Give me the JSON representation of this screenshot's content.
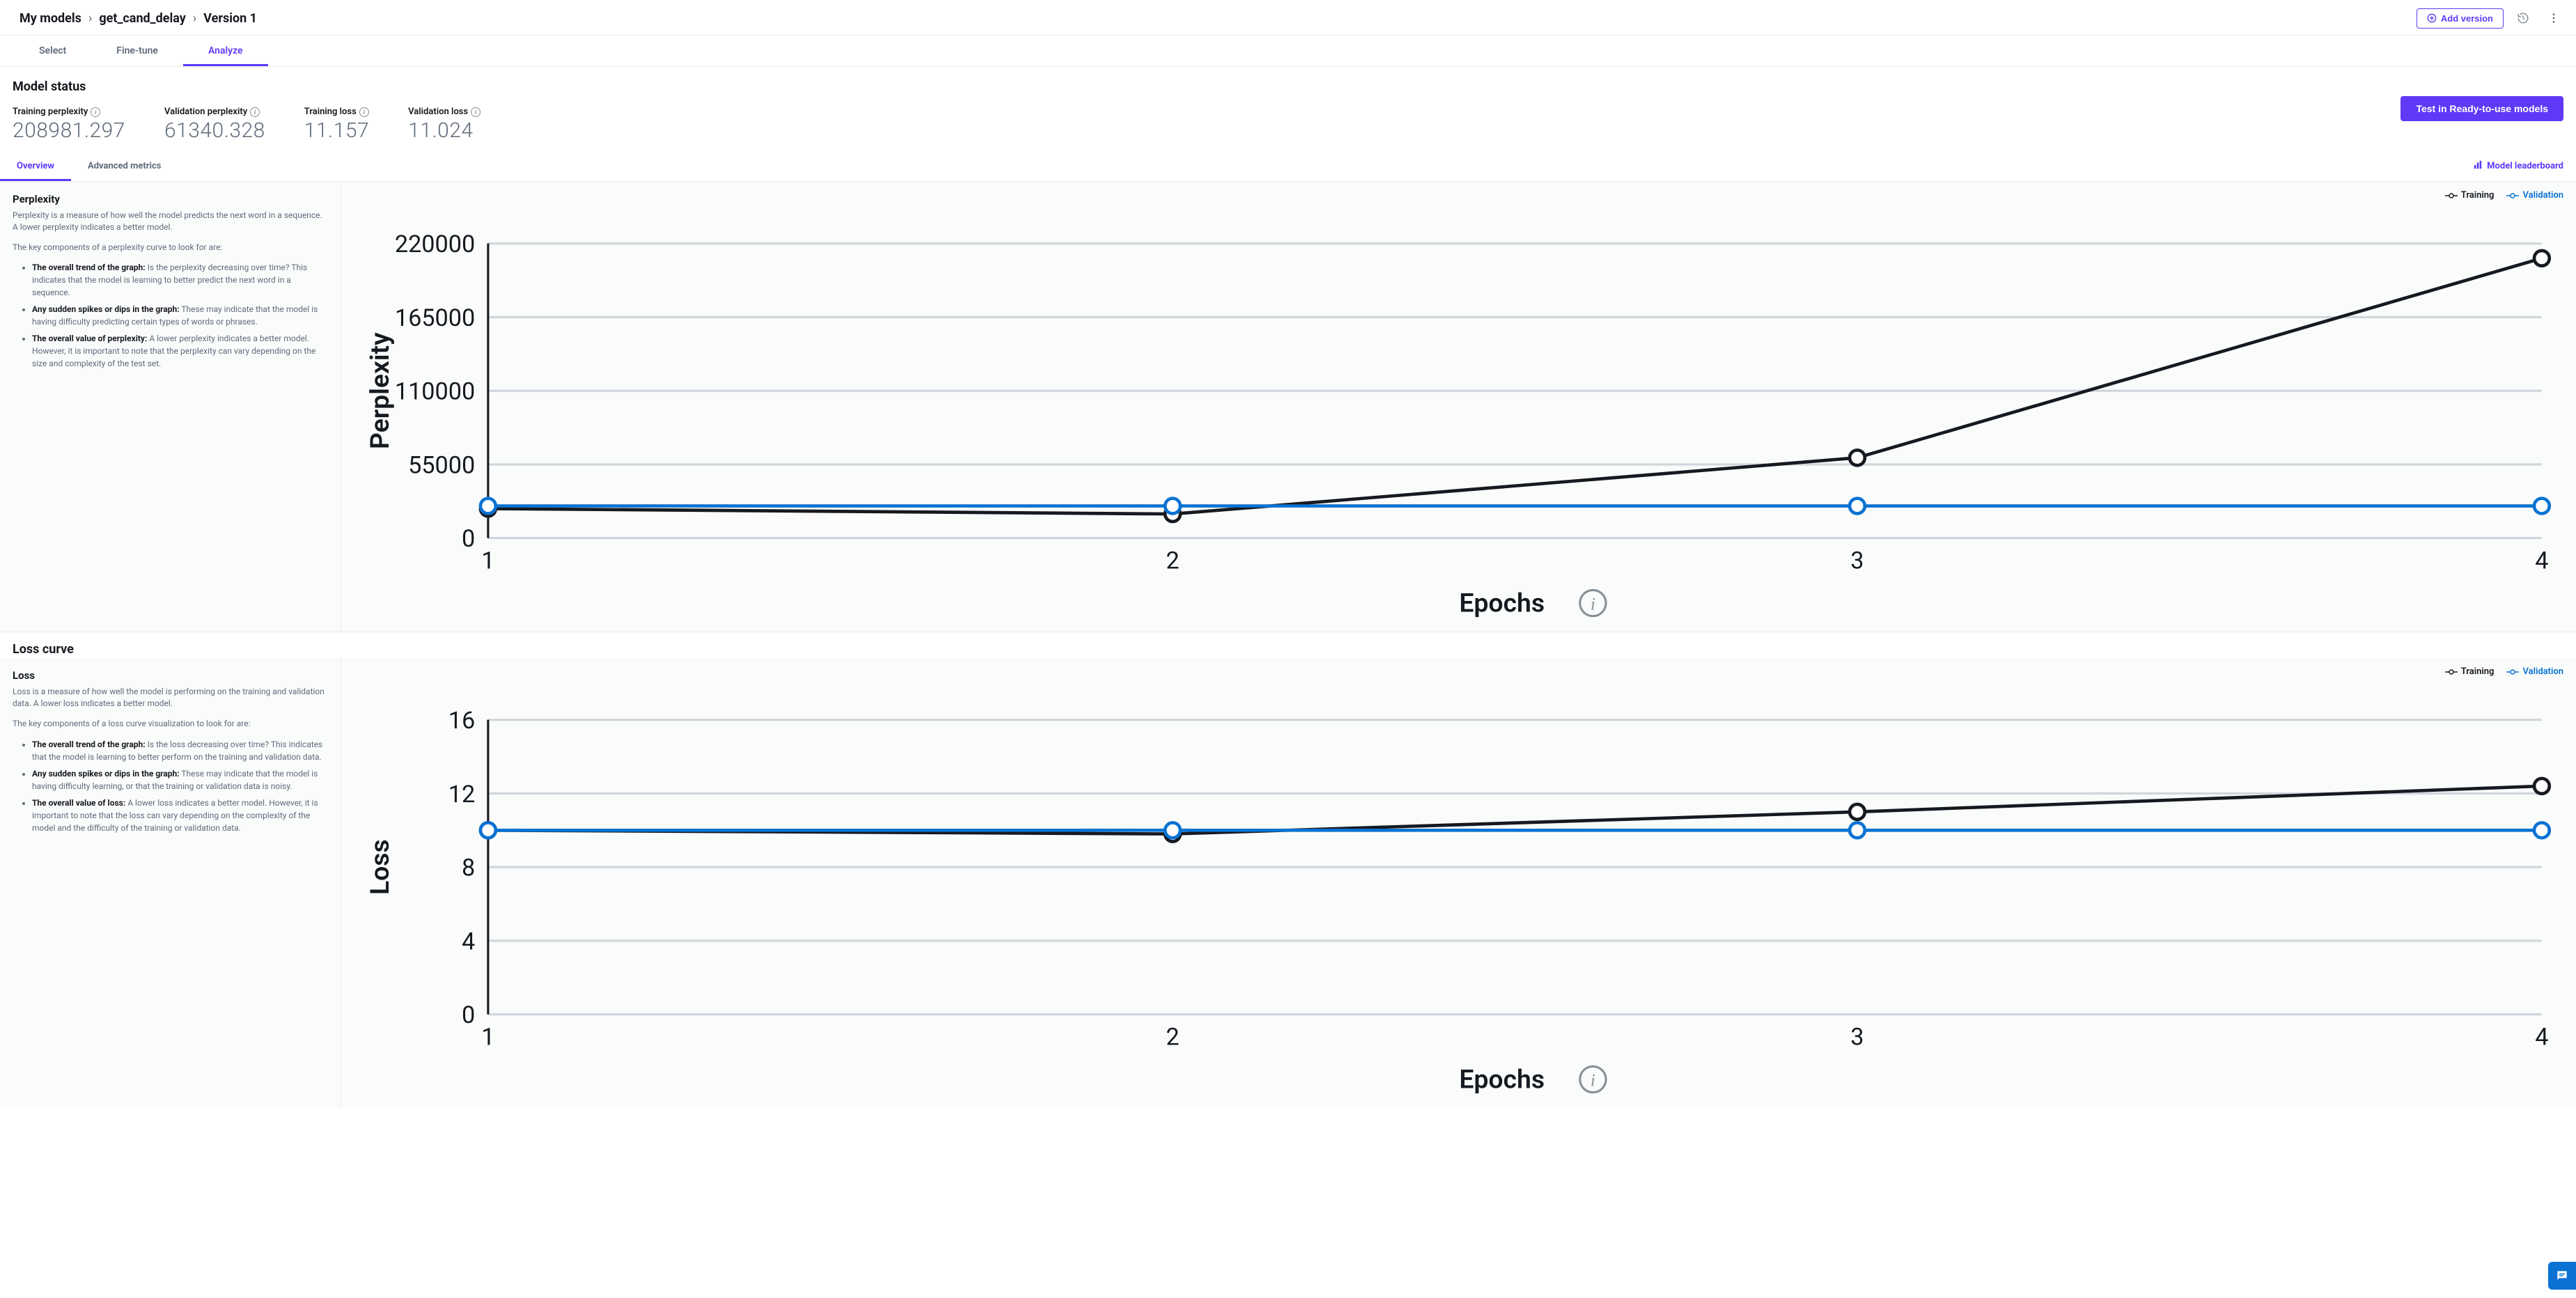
{
  "breadcrumb": {
    "root": "My models",
    "model": "get_cand_delay",
    "version": "Version 1"
  },
  "top_actions": {
    "add_version": "Add version"
  },
  "primary_tabs": {
    "select": "Select",
    "fine_tune": "Fine-tune",
    "analyze": "Analyze"
  },
  "status": {
    "heading": "Model status",
    "metrics": {
      "training_perplexity_label": "Training perplexity",
      "training_perplexity_value": "208981.297",
      "validation_perplexity_label": "Validation perplexity",
      "validation_perplexity_value": "61340.328",
      "training_loss_label": "Training loss",
      "training_loss_value": "11.157",
      "validation_loss_label": "Validation loss",
      "validation_loss_value": "11.024"
    },
    "test_button": "Test in Ready-to-use models"
  },
  "secondary_tabs": {
    "overview": "Overview",
    "advanced": "Advanced metrics",
    "leaderboard": "Model leaderboard"
  },
  "perplexity_section": {
    "heading": "Perplexity",
    "intro": "Perplexity is a measure of how well the model predicts the next word in a sequence. A lower perplexity indicates a better model.",
    "components_lead": "The key components of a perplexity curve to look for are:",
    "b1_bold": "The overall trend of the graph:",
    "b1_rest": " Is the perplexity decreasing over time? This indicates that the model is learning to better predict the next word in a sequence.",
    "b2_bold": "Any sudden spikes or dips in the graph:",
    "b2_rest": " These may indicate that the model is having difficulty predicting certain types of words or phrases.",
    "b3_bold": "The overall value of perplexity:",
    "b3_rest": " A lower perplexity indicates a better model. However, it is important to note that the perplexity can vary depending on the size and complexity of the test set."
  },
  "loss_heading": "Loss curve",
  "loss_section": {
    "heading": "Loss",
    "intro": "Loss is a measure of how well the model is performing on the training and validation data. A lower loss indicates a better model.",
    "components_lead": "The key components of a loss curve visualization to look for are:",
    "b1_bold": "The overall trend of the graph:",
    "b1_rest": " Is the loss decreasing over time? This indicates that the model is learning to better perform on the training and validation data.",
    "b2_bold": "Any sudden spikes or dips in the graph:",
    "b2_rest": " These may indicate that the model is having difficulty learning, or that the training or validation data is noisy.",
    "b3_bold": "The overall value of loss:",
    "b3_rest": " A lower loss indicates a better model. However, it is important to note that the loss can vary depending on the complexity of the model and the difficulty of the training or validation data."
  },
  "chart_common": {
    "xlabel": "Epochs",
    "legend_training": "Training",
    "legend_validation": "Validation"
  },
  "chart_data": [
    {
      "id": "perplexity",
      "type": "line",
      "xlabel": "Epochs",
      "ylabel": "Perplexity",
      "x": [
        1,
        2,
        3,
        4
      ],
      "x_ticks": [
        1,
        2,
        3,
        4
      ],
      "y_ticks": [
        0,
        55000,
        110000,
        165000,
        220000
      ],
      "ylim": [
        0,
        220000
      ],
      "series": [
        {
          "name": "Training",
          "values": [
            22000,
            18000,
            60000,
            208981
          ]
        },
        {
          "name": "Validation",
          "values": [
            24000,
            24000,
            24000,
            24000
          ]
        }
      ]
    },
    {
      "id": "loss",
      "type": "line",
      "xlabel": "Epochs",
      "ylabel": "Loss",
      "x": [
        1,
        2,
        3,
        4
      ],
      "x_ticks": [
        1,
        2,
        3,
        4
      ],
      "y_ticks": [
        0,
        4,
        8,
        12,
        16
      ],
      "ylim": [
        0,
        16
      ],
      "series": [
        {
          "name": "Training",
          "values": [
            10.0,
            9.8,
            11.0,
            12.4
          ]
        },
        {
          "name": "Validation",
          "values": [
            10.0,
            10.0,
            10.0,
            10.0
          ]
        }
      ]
    }
  ]
}
